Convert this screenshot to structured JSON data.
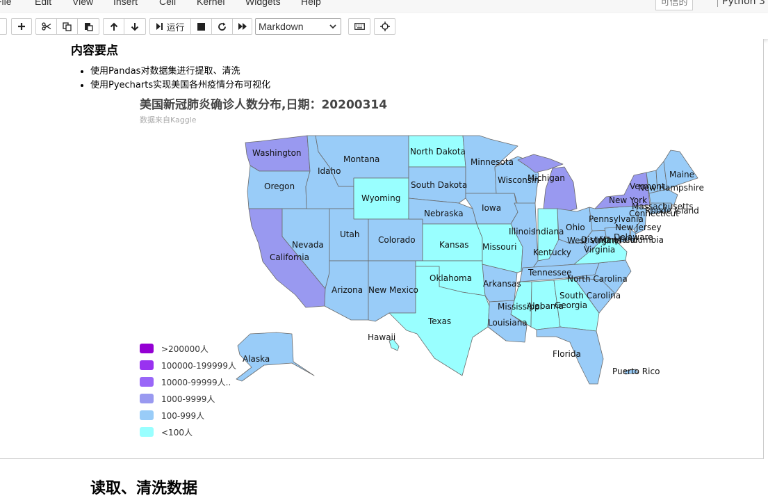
{
  "menu": {
    "items": [
      "File",
      "Edit",
      "View",
      "Insert",
      "Cell",
      "Kernel",
      "Widgets",
      "Help"
    ],
    "trusted": "可信的",
    "kernel": "Python 3"
  },
  "toolbar": {
    "run_label": "运行",
    "cell_type": "Markdown"
  },
  "cell": {
    "heading": "内容要点",
    "points": [
      "使用Pandas对数据集进行提取、清洗",
      "使用Pyecharts实现美国各州疫情分布可视化"
    ],
    "next_heading": "读取、清洗数据"
  },
  "chart_data": {
    "type": "map",
    "title": "美国新冠肺炎确诊人数分布,日期：20200314",
    "subtitle": "数据来自Kaggle",
    "legend": [
      {
        "label": ">200000人",
        "color": "#9400d3"
      },
      {
        "label": "100000-199999人",
        "color": "#9932f0"
      },
      {
        "label": "10000-99999人..",
        "color": "#9966f8"
      },
      {
        "label": "1000-9999人",
        "color": "#9999f0"
      },
      {
        "label": "100-999人",
        "color": "#99ccf8"
      },
      {
        "label": "<100人",
        "color": "#99ffff"
      }
    ],
    "colors": {
      "lt100": "#99ffff",
      "r100": "#99ccf8",
      "r1000": "#9999f0",
      "r10000": "#9966f8"
    },
    "states": [
      {
        "name": "Washington",
        "range": "1000-9999人"
      },
      {
        "name": "Oregon",
        "range": "100-999人"
      },
      {
        "name": "California",
        "range": "1000-9999人"
      },
      {
        "name": "Nevada",
        "range": "100-999人"
      },
      {
        "name": "Idaho",
        "range": "100-999人"
      },
      {
        "name": "Montana",
        "range": "100-999人"
      },
      {
        "name": "Wyoming",
        "range": "<100人"
      },
      {
        "name": "Utah",
        "range": "100-999人"
      },
      {
        "name": "Colorado",
        "range": "100-999人"
      },
      {
        "name": "Arizona",
        "range": "100-999人"
      },
      {
        "name": "New Mexico",
        "range": "100-999人"
      },
      {
        "name": "North Dakota",
        "range": "<100人"
      },
      {
        "name": "South Dakota",
        "range": "100-999人"
      },
      {
        "name": "Nebraska",
        "range": "100-999人"
      },
      {
        "name": "Kansas",
        "range": "<100人"
      },
      {
        "name": "Oklahoma",
        "range": "<100人"
      },
      {
        "name": "Texas",
        "range": "<100人"
      },
      {
        "name": "Minnesota",
        "range": "100-999人"
      },
      {
        "name": "Iowa",
        "range": "100-999人"
      },
      {
        "name": "Missouri",
        "range": "<100人"
      },
      {
        "name": "Arkansas",
        "range": "100-999人"
      },
      {
        "name": "Louisiana",
        "range": "100-999人"
      },
      {
        "name": "Wisconsin",
        "range": "100-999人"
      },
      {
        "name": "Illinois",
        "range": "100-999人"
      },
      {
        "name": "Michigan",
        "range": "1000-9999人"
      },
      {
        "name": "Indiana",
        "range": "<100人"
      },
      {
        "name": "Ohio",
        "range": "100-999人"
      },
      {
        "name": "Kentucky",
        "range": "100-999人"
      },
      {
        "name": "Tennessee",
        "range": "100-999人"
      },
      {
        "name": "Mississippi",
        "range": "<100人"
      },
      {
        "name": "Alabama",
        "range": "<100人"
      },
      {
        "name": "Georgia",
        "range": "<100人"
      },
      {
        "name": "Florida",
        "range": "100-999人"
      },
      {
        "name": "South Carolina",
        "range": "100-999人"
      },
      {
        "name": "North Carolina",
        "range": "100-999人"
      },
      {
        "name": "Virginia",
        "range": "<100人"
      },
      {
        "name": "West Virginia",
        "range": "100-999人"
      },
      {
        "name": "Pennsylvania",
        "range": "100-999人"
      },
      {
        "name": "New York",
        "range": "1000-9999人"
      },
      {
        "name": "New Jersey",
        "range": "100-999人"
      },
      {
        "name": "Delaware",
        "range": "100-999人"
      },
      {
        "name": "Maryland",
        "range": "100-999人"
      },
      {
        "name": "District of Columbia",
        "range": "100-999人"
      },
      {
        "name": "Connecticut",
        "range": "100-999人"
      },
      {
        "name": "Rhode Island",
        "range": "100-999人"
      },
      {
        "name": "Massachusetts",
        "range": "100-999人"
      },
      {
        "name": "Vermont",
        "range": "100-999人"
      },
      {
        "name": "New Hampshire",
        "range": "100-999人"
      },
      {
        "name": "Maine",
        "range": "100-999人"
      },
      {
        "name": "Alaska",
        "range": "100-999人"
      },
      {
        "name": "Hawaii",
        "range": "<100人"
      },
      {
        "name": "Puerto Rico",
        "range": "100-999人"
      }
    ]
  }
}
